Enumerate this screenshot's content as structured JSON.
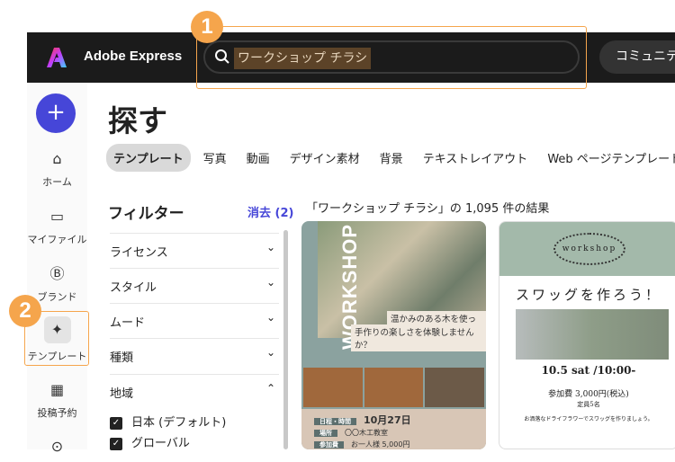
{
  "header": {
    "app_name": "Adobe Express",
    "search_value": "ワークショップ チラシ",
    "community_label": "コミュニティ"
  },
  "annotations": {
    "badge1": "1",
    "badge2": "2"
  },
  "sidebar": {
    "create_label": "+",
    "items": [
      {
        "label": "ホーム",
        "icon": "home-icon"
      },
      {
        "label": "マイファイル",
        "icon": "folder-icon"
      },
      {
        "label": "ブランド",
        "icon": "brand-icon"
      },
      {
        "label": "テンプレート",
        "icon": "template-icon"
      },
      {
        "label": "投稿予約",
        "icon": "calendar-icon"
      }
    ]
  },
  "page": {
    "title": "探す"
  },
  "tabs": [
    "テンプレート",
    "写真",
    "動画",
    "デザイン素材",
    "背景",
    "テキストレイアウト",
    "Web ページテンプレート"
  ],
  "filters": {
    "title": "フィルター",
    "clear": "消去 (2)",
    "sections": [
      "ライセンス",
      "スタイル",
      "ムード",
      "種類",
      "地域"
    ],
    "region_options": [
      "日本 (デフォルト)",
      "グローバル"
    ]
  },
  "results": {
    "summary": "「ワークショップ チラシ」の 1,095 件の結果"
  },
  "cards": [
    {
      "vertical": "WORKSHOP",
      "caption1": "温かみのある木を使って",
      "caption2": "手作りの楽しさを体験しませんか？",
      "date": "10月27日",
      "place": "〇〇木工教室",
      "fee": "お一人様 5,000円",
      "labels": [
        "日程・時間",
        "場所",
        "参加費"
      ]
    },
    {
      "badge": "workshop",
      "title": "スワッグを作ろう！",
      "date": "10.5 sat /10:00-",
      "fee": "参加費 3,000円(税込)",
      "capacity": "定員5名",
      "desc": "お洒落なドライフラワーでスワッグを作りましょう。"
    }
  ],
  "colors": {
    "accent": "#4646d8",
    "highlight": "#f5a54c",
    "header_bg": "#1b1b1b"
  }
}
